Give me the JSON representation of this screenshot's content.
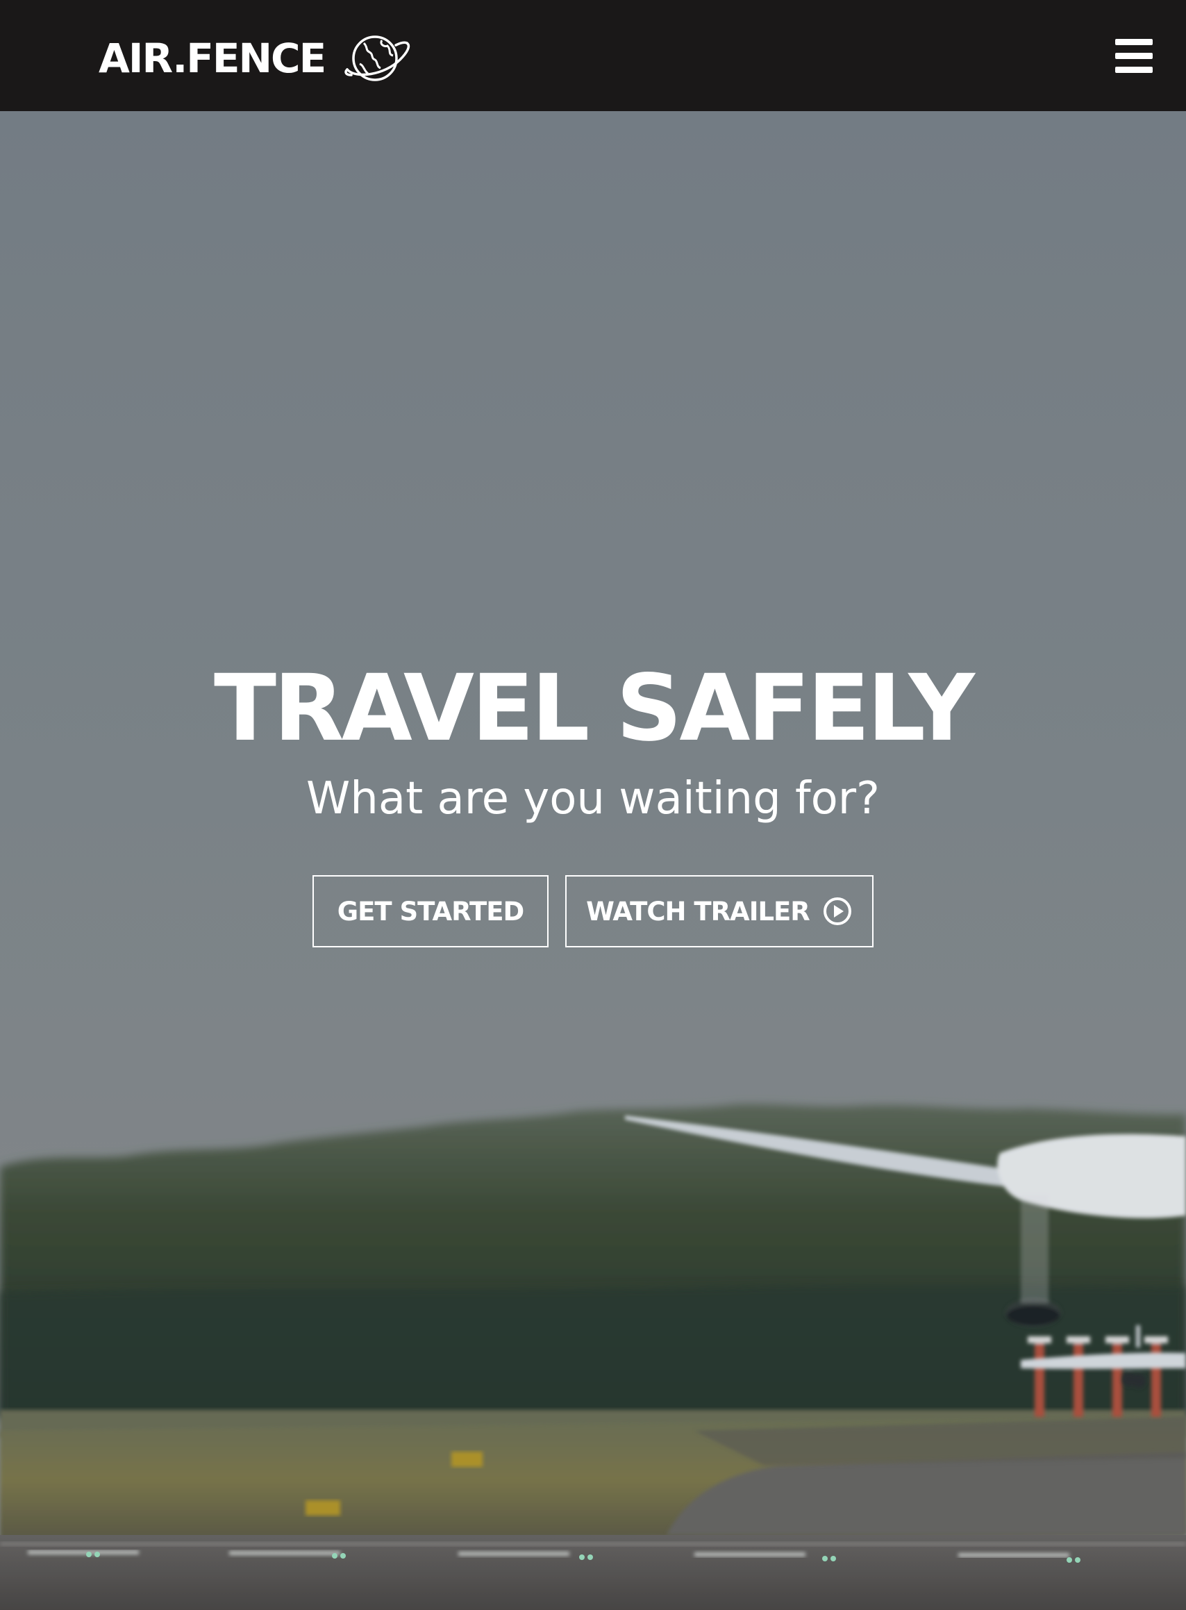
{
  "navbar": {
    "brand": "AIR.FENCE",
    "logo_icon": "globe-orbit-icon",
    "menu_icon": "hamburger-menu-icon"
  },
  "hero": {
    "title": "TRAVEL SAFELY",
    "subtitle": "What are you waiting for?",
    "background": "airplane-landing-runway-photo",
    "buttons": {
      "get_started": "GET STARTED",
      "watch_trailer": "WATCH TRAILER",
      "watch_trailer_icon": "play-circle-icon"
    }
  },
  "colors": {
    "navbar_bg": "#1a1818",
    "text": "#ffffff",
    "sky": "#808a92"
  }
}
